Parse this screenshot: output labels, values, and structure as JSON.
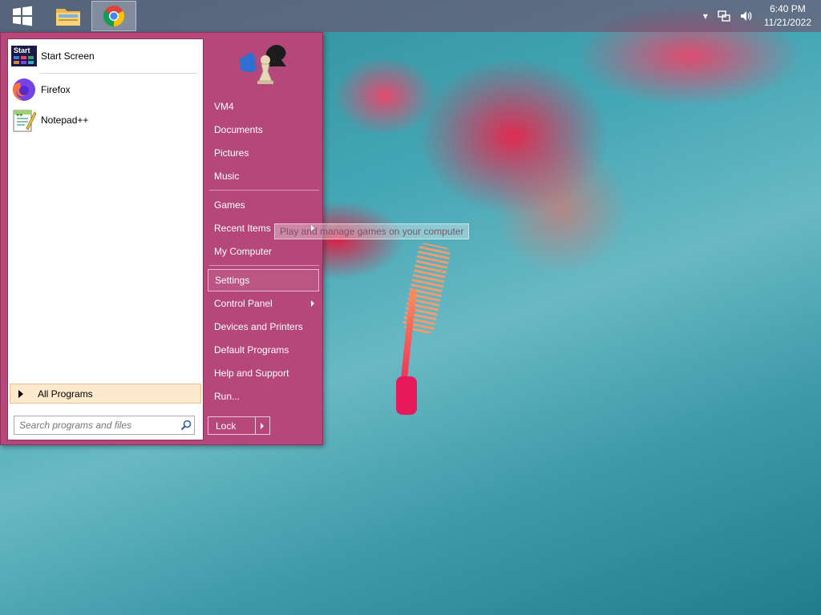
{
  "taskbar": {
    "pinned": [
      {
        "name": "start-button",
        "icon": "windows-logo-icon"
      },
      {
        "name": "file-explorer",
        "icon": "folder-icon"
      },
      {
        "name": "chrome",
        "icon": "chrome-icon",
        "active": true
      }
    ],
    "tray": {
      "icons": [
        "show-hidden-icons-icon",
        "network-icon",
        "volume-icon"
      ],
      "time": "6:40 PM",
      "date": "11/21/2022"
    }
  },
  "start_menu": {
    "programs": [
      {
        "label": "Start Screen",
        "icon": "start-screen-icon"
      },
      {
        "label": "Firefox",
        "icon": "firefox-icon"
      },
      {
        "label": "Notepad++",
        "icon": "notepad-plus-plus-icon"
      }
    ],
    "all_programs_label": "All Programs",
    "search_placeholder": "Search programs and files",
    "right_items_group1": [
      "VM4",
      "Documents",
      "Pictures",
      "Music"
    ],
    "right_items_group2": [
      "Games",
      "Recent Items",
      "My Computer"
    ],
    "right_items_group3": [
      "Settings",
      "Control Panel",
      "Devices and Printers",
      "Default Programs",
      "Help and Support",
      "Run..."
    ],
    "lock_label": "Lock",
    "tooltip": "Play and manage games on your computer",
    "colors": {
      "accent": "#b5477a",
      "all_programs_bg": "#fde9cc"
    }
  }
}
